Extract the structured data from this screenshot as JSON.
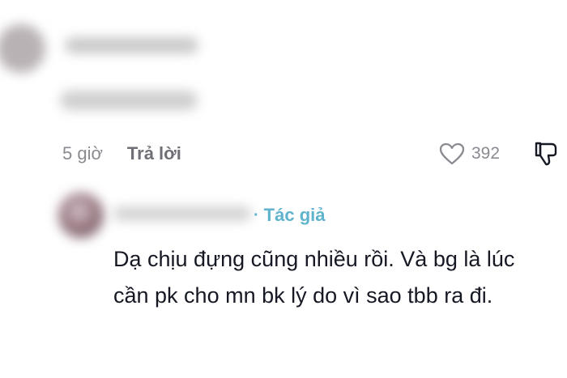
{
  "comment": {
    "time": "5 giờ",
    "reply_label": "Trả lời",
    "like_icon": "heart-outline-icon",
    "like_count": "392",
    "dislike_icon": "thumbs-down-icon"
  },
  "reply": {
    "author_badge": "Tác giả",
    "text": "Dạ chịu đựng cũng nhiều rồi. Và bg là lúc cần pk cho mn bk lý do vì sao tbb ra đi."
  },
  "colors": {
    "badge": "#5fb3cc",
    "muted": "#8a8b91",
    "text": "#161823"
  }
}
